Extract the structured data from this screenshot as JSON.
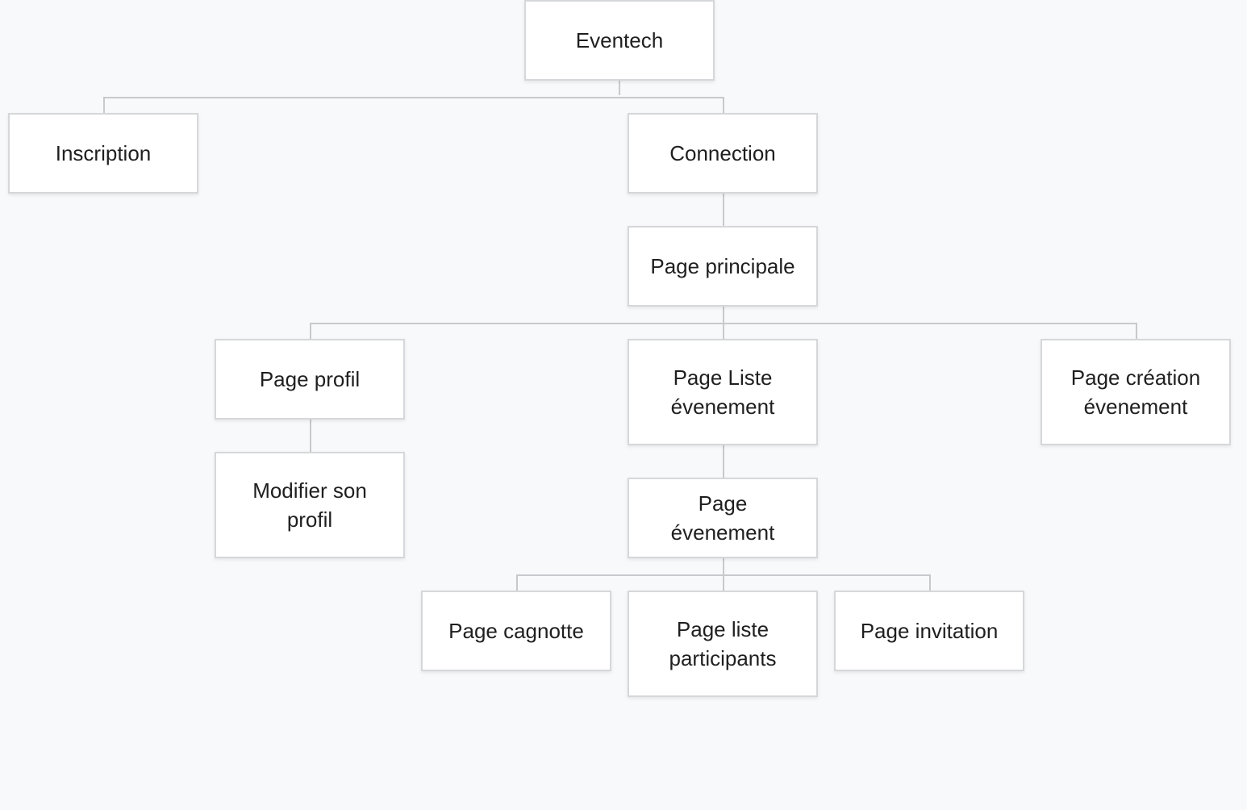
{
  "diagram": {
    "nodes": {
      "eventech": "Eventech",
      "inscription": "Inscription",
      "connection": "Connection",
      "page_principale": "Page principale",
      "page_profil": "Page profil",
      "page_liste_evenement": "Page Liste évenement",
      "page_creation_evenement": "Page création évenement",
      "modifier_son_profil": "Modifier son profil",
      "page_evenement": "Page évenement",
      "page_cagnotte": "Page cagnotte",
      "page_liste_participants": "Page liste participants",
      "page_invitation": "Page invitation"
    },
    "edges": [
      [
        "eventech",
        "inscription"
      ],
      [
        "eventech",
        "connection"
      ],
      [
        "connection",
        "page_principale"
      ],
      [
        "page_principale",
        "page_profil"
      ],
      [
        "page_principale",
        "page_liste_evenement"
      ],
      [
        "page_principale",
        "page_creation_evenement"
      ],
      [
        "page_profil",
        "modifier_son_profil"
      ],
      [
        "page_liste_evenement",
        "page_evenement"
      ],
      [
        "page_evenement",
        "page_cagnotte"
      ],
      [
        "page_evenement",
        "page_liste_participants"
      ],
      [
        "page_evenement",
        "page_invitation"
      ]
    ],
    "colors": {
      "background": "#f8f9fa",
      "node_fill": "#ffffff",
      "node_border": "#d6d7da",
      "connector": "#c8c9cc",
      "text": "#1f1f1f"
    }
  }
}
